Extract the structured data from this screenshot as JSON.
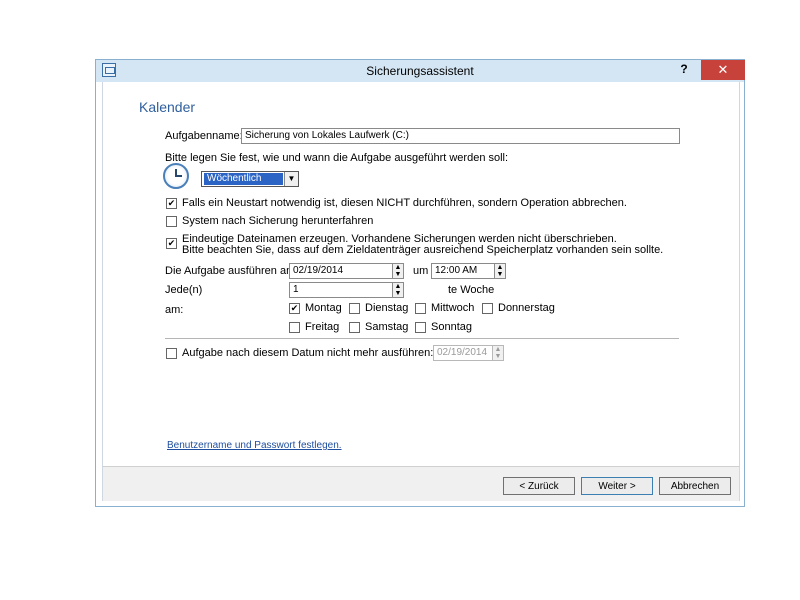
{
  "window": {
    "title": "Sicherungsassistent",
    "help": "?",
    "close": "✕"
  },
  "page": {
    "title": "Kalender"
  },
  "task_name": {
    "label": "Aufgabenname:",
    "value": "Sicherung von Lokales Laufwerk (C:)"
  },
  "schedule": {
    "prompt": "Bitte legen Sie fest, wie und wann die Aufgabe ausgeführt werden soll:",
    "frequency": "Wöchentlich",
    "frequency_icon": "clock-icon"
  },
  "options": [
    {
      "label": "Falls ein Neustart notwendig ist, diesen NICHT durchführen, sondern Operation abbrechen.",
      "checked": true
    },
    {
      "label": "System nach Sicherung herunterfahren",
      "checked": false
    },
    {
      "label": "Eindeutige Dateinamen erzeugen. Vorhandene Sicherungen werden nicht überschrieben.",
      "label2": "Bitte beachten Sie, dass auf dem Zieldatenträger ausreichend Speicherplatz vorhanden sein sollte.",
      "checked": true
    }
  ],
  "run": {
    "label": "Die Aufgabe ausführen am:",
    "date": "02/19/2014",
    "at_label": "um",
    "time": "12:00 AM"
  },
  "every": {
    "label": "Jede(n)",
    "value": "1",
    "suffix": "te Woche"
  },
  "days": {
    "label": "am:",
    "items": [
      {
        "name": "Montag",
        "checked": true
      },
      {
        "name": "Dienstag",
        "checked": false
      },
      {
        "name": "Mittwoch",
        "checked": false
      },
      {
        "name": "Donnerstag",
        "checked": false
      },
      {
        "name": "Freitag",
        "checked": false
      },
      {
        "name": "Samstag",
        "checked": false
      },
      {
        "name": "Sonntag",
        "checked": false
      }
    ]
  },
  "end": {
    "label": "Aufgabe nach diesem Datum nicht mehr ausführen:",
    "checked": false,
    "date": "02/19/2014"
  },
  "credentials_link": "Benutzername und Passwort festlegen.",
  "buttons": {
    "back": "< Zurück",
    "next": "Weiter >",
    "cancel": "Abbrechen"
  }
}
